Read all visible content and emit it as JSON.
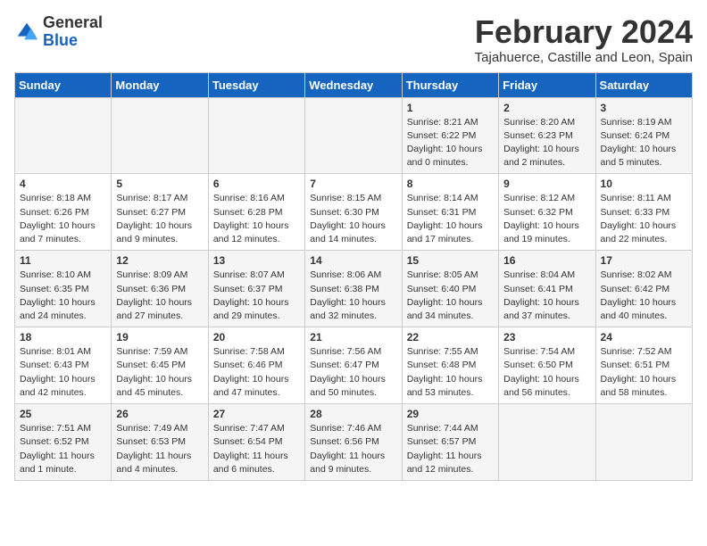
{
  "header": {
    "logo_general": "General",
    "logo_blue": "Blue",
    "month_title": "February 2024",
    "location": "Tajahuerce, Castille and Leon, Spain"
  },
  "days_of_week": [
    "Sunday",
    "Monday",
    "Tuesday",
    "Wednesday",
    "Thursday",
    "Friday",
    "Saturday"
  ],
  "weeks": [
    [
      {
        "day": "",
        "info": ""
      },
      {
        "day": "",
        "info": ""
      },
      {
        "day": "",
        "info": ""
      },
      {
        "day": "",
        "info": ""
      },
      {
        "day": "1",
        "info": "Sunrise: 8:21 AM\nSunset: 6:22 PM\nDaylight: 10 hours\nand 0 minutes."
      },
      {
        "day": "2",
        "info": "Sunrise: 8:20 AM\nSunset: 6:23 PM\nDaylight: 10 hours\nand 2 minutes."
      },
      {
        "day": "3",
        "info": "Sunrise: 8:19 AM\nSunset: 6:24 PM\nDaylight: 10 hours\nand 5 minutes."
      }
    ],
    [
      {
        "day": "4",
        "info": "Sunrise: 8:18 AM\nSunset: 6:26 PM\nDaylight: 10 hours\nand 7 minutes."
      },
      {
        "day": "5",
        "info": "Sunrise: 8:17 AM\nSunset: 6:27 PM\nDaylight: 10 hours\nand 9 minutes."
      },
      {
        "day": "6",
        "info": "Sunrise: 8:16 AM\nSunset: 6:28 PM\nDaylight: 10 hours\nand 12 minutes."
      },
      {
        "day": "7",
        "info": "Sunrise: 8:15 AM\nSunset: 6:30 PM\nDaylight: 10 hours\nand 14 minutes."
      },
      {
        "day": "8",
        "info": "Sunrise: 8:14 AM\nSunset: 6:31 PM\nDaylight: 10 hours\nand 17 minutes."
      },
      {
        "day": "9",
        "info": "Sunrise: 8:12 AM\nSunset: 6:32 PM\nDaylight: 10 hours\nand 19 minutes."
      },
      {
        "day": "10",
        "info": "Sunrise: 8:11 AM\nSunset: 6:33 PM\nDaylight: 10 hours\nand 22 minutes."
      }
    ],
    [
      {
        "day": "11",
        "info": "Sunrise: 8:10 AM\nSunset: 6:35 PM\nDaylight: 10 hours\nand 24 minutes."
      },
      {
        "day": "12",
        "info": "Sunrise: 8:09 AM\nSunset: 6:36 PM\nDaylight: 10 hours\nand 27 minutes."
      },
      {
        "day": "13",
        "info": "Sunrise: 8:07 AM\nSunset: 6:37 PM\nDaylight: 10 hours\nand 29 minutes."
      },
      {
        "day": "14",
        "info": "Sunrise: 8:06 AM\nSunset: 6:38 PM\nDaylight: 10 hours\nand 32 minutes."
      },
      {
        "day": "15",
        "info": "Sunrise: 8:05 AM\nSunset: 6:40 PM\nDaylight: 10 hours\nand 34 minutes."
      },
      {
        "day": "16",
        "info": "Sunrise: 8:04 AM\nSunset: 6:41 PM\nDaylight: 10 hours\nand 37 minutes."
      },
      {
        "day": "17",
        "info": "Sunrise: 8:02 AM\nSunset: 6:42 PM\nDaylight: 10 hours\nand 40 minutes."
      }
    ],
    [
      {
        "day": "18",
        "info": "Sunrise: 8:01 AM\nSunset: 6:43 PM\nDaylight: 10 hours\nand 42 minutes."
      },
      {
        "day": "19",
        "info": "Sunrise: 7:59 AM\nSunset: 6:45 PM\nDaylight: 10 hours\nand 45 minutes."
      },
      {
        "day": "20",
        "info": "Sunrise: 7:58 AM\nSunset: 6:46 PM\nDaylight: 10 hours\nand 47 minutes."
      },
      {
        "day": "21",
        "info": "Sunrise: 7:56 AM\nSunset: 6:47 PM\nDaylight: 10 hours\nand 50 minutes."
      },
      {
        "day": "22",
        "info": "Sunrise: 7:55 AM\nSunset: 6:48 PM\nDaylight: 10 hours\nand 53 minutes."
      },
      {
        "day": "23",
        "info": "Sunrise: 7:54 AM\nSunset: 6:50 PM\nDaylight: 10 hours\nand 56 minutes."
      },
      {
        "day": "24",
        "info": "Sunrise: 7:52 AM\nSunset: 6:51 PM\nDaylight: 10 hours\nand 58 minutes."
      }
    ],
    [
      {
        "day": "25",
        "info": "Sunrise: 7:51 AM\nSunset: 6:52 PM\nDaylight: 11 hours\nand 1 minute."
      },
      {
        "day": "26",
        "info": "Sunrise: 7:49 AM\nSunset: 6:53 PM\nDaylight: 11 hours\nand 4 minutes."
      },
      {
        "day": "27",
        "info": "Sunrise: 7:47 AM\nSunset: 6:54 PM\nDaylight: 11 hours\nand 6 minutes."
      },
      {
        "day": "28",
        "info": "Sunrise: 7:46 AM\nSunset: 6:56 PM\nDaylight: 11 hours\nand 9 minutes."
      },
      {
        "day": "29",
        "info": "Sunrise: 7:44 AM\nSunset: 6:57 PM\nDaylight: 11 hours\nand 12 minutes."
      },
      {
        "day": "",
        "info": ""
      },
      {
        "day": "",
        "info": ""
      }
    ]
  ]
}
